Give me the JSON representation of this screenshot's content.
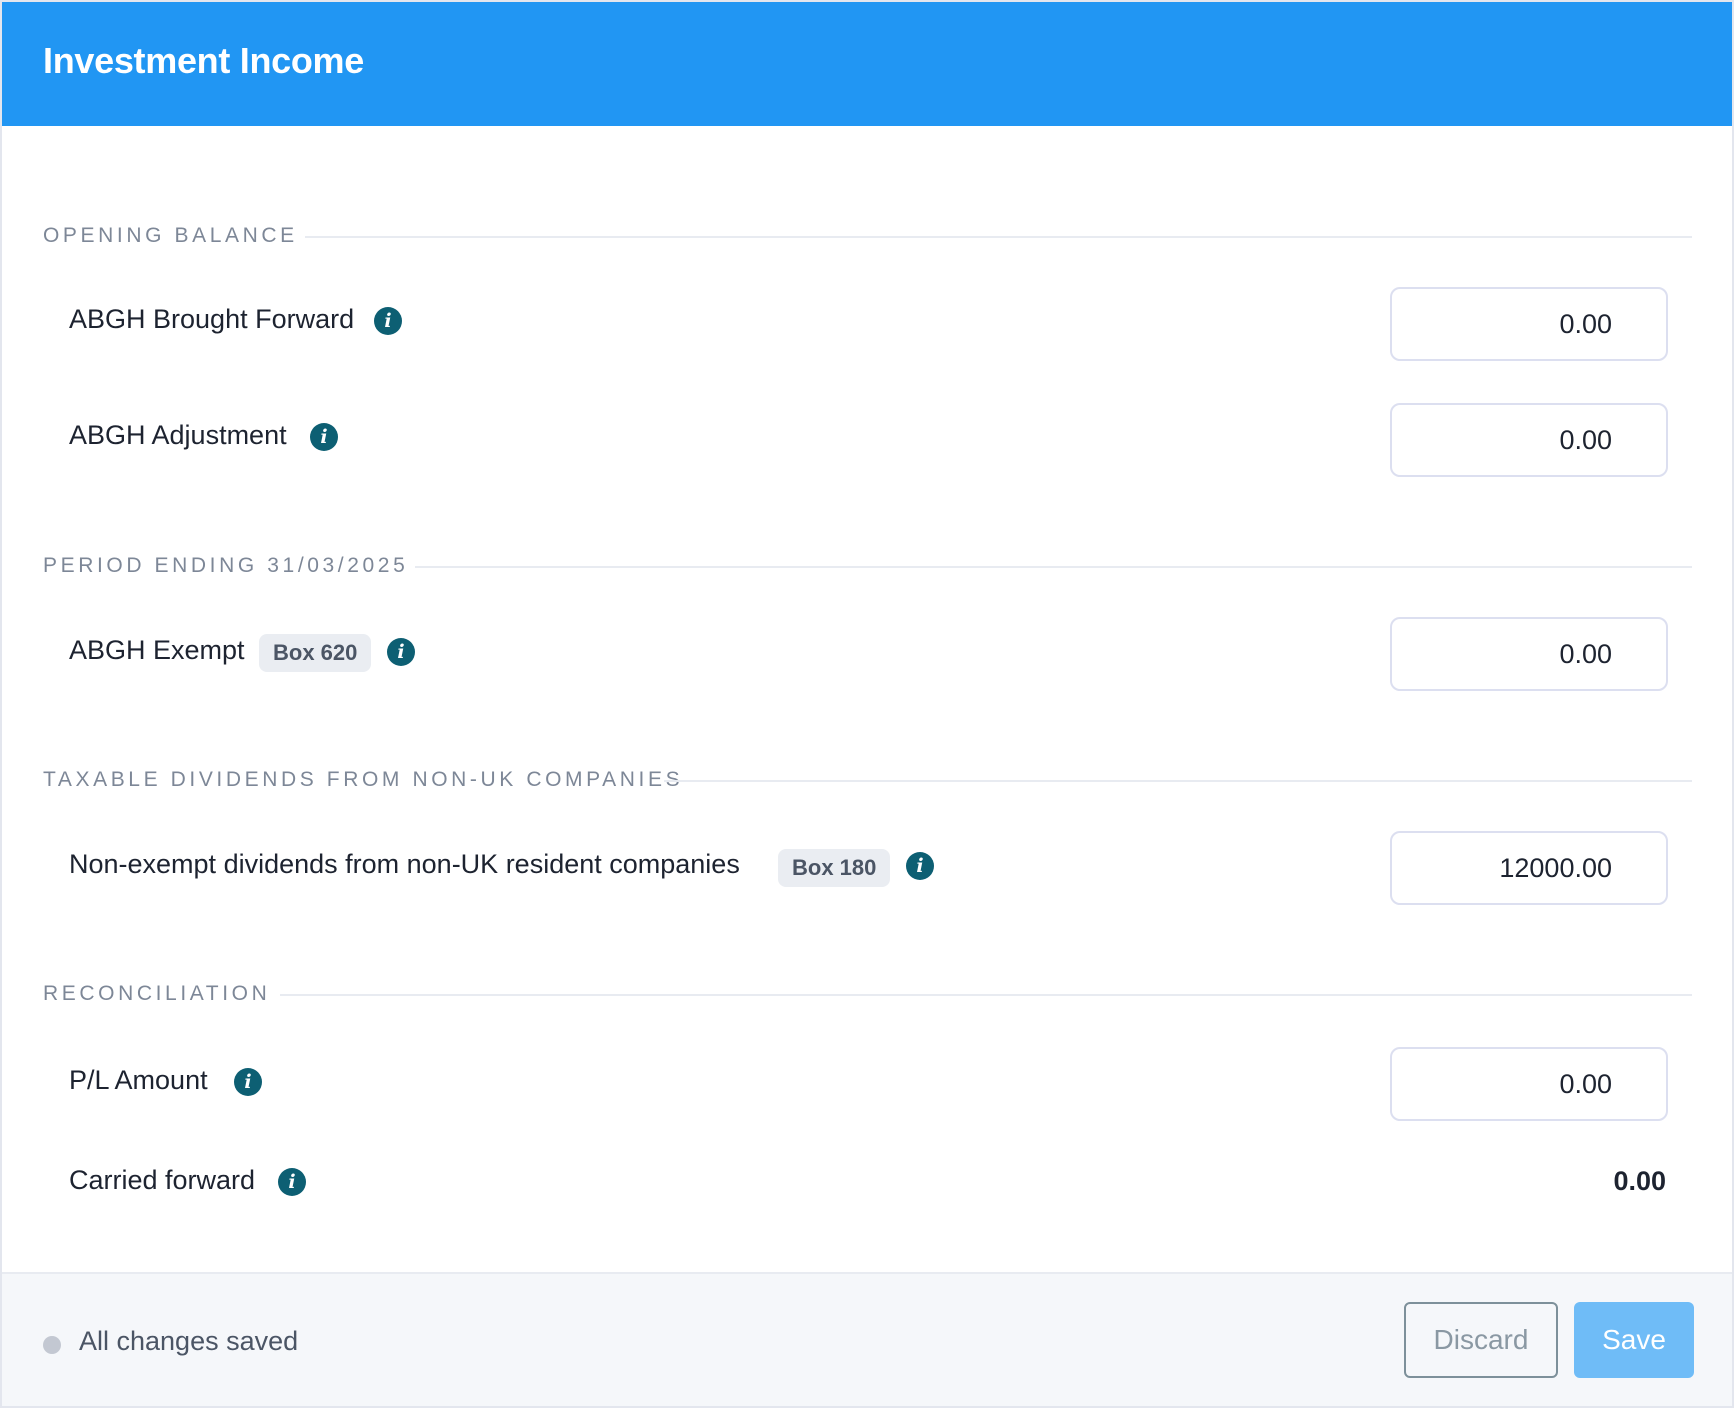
{
  "header": {
    "title": "Investment Income"
  },
  "sections": {
    "opening_balance": {
      "label": "OPENING BALANCE",
      "rows": {
        "brought_forward": {
          "label": "ABGH Brought Forward",
          "value": "0.00"
        },
        "adjustment": {
          "label": "ABGH Adjustment",
          "value": "0.00"
        }
      }
    },
    "period_ending": {
      "label": "PERIOD ENDING 31/03/2025",
      "rows": {
        "exempt": {
          "label": "ABGH Exempt",
          "badge": "Box 620",
          "value": "0.00"
        }
      }
    },
    "taxable_dividends": {
      "label": "TAXABLE DIVIDENDS FROM NON-UK COMPANIES",
      "rows": {
        "non_exempt": {
          "label": "Non-exempt dividends from non-UK resident companies",
          "badge": "Box 180",
          "value": "12000.00"
        }
      }
    },
    "reconciliation": {
      "label": "RECONCILIATION",
      "rows": {
        "pl_amount": {
          "label": "P/L Amount",
          "value": "0.00"
        },
        "carried_forward": {
          "label": "Carried forward",
          "value": "0.00"
        }
      }
    }
  },
  "info_icon_glyph": "i",
  "footer": {
    "status": "All changes saved",
    "discard_label": "Discard",
    "save_label": "Save"
  },
  "colors": {
    "header": "#2196f3",
    "info_icon": "#0d5f73",
    "save_button": "#6fbcf7"
  }
}
